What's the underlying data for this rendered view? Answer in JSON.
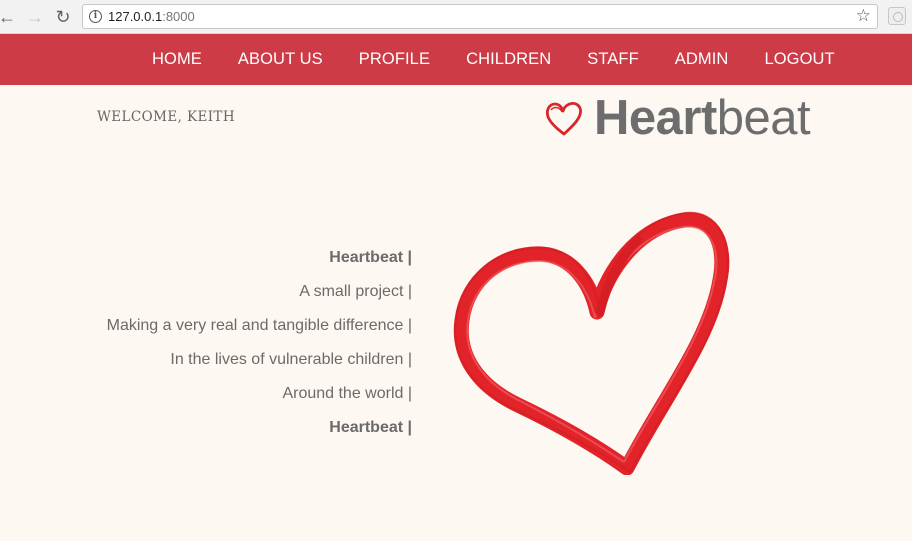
{
  "browser": {
    "url_host": "127.0.0.1",
    "url_port": ":8000",
    "back_icon": "arrow-left",
    "forward_icon": "arrow-right",
    "reload_icon": "reload",
    "bookmark_icon": "star-outline"
  },
  "nav": {
    "items": [
      {
        "label": "HOME"
      },
      {
        "label": "ABOUT US"
      },
      {
        "label": "PROFILE"
      },
      {
        "label": "CHILDREN"
      },
      {
        "label": "STAFF"
      },
      {
        "label": "ADMIN"
      },
      {
        "label": "LOGOUT"
      }
    ]
  },
  "header": {
    "welcome": "WELCOME, KEITH",
    "logo_bold": "Heart",
    "logo_light": "beat"
  },
  "tagline": {
    "lines": [
      "Heartbeat |",
      "A small project |",
      "Making a very real and tangible difference |",
      "In the lives of vulnerable children |",
      "Around the world |",
      "Heartbeat |"
    ]
  },
  "colors": {
    "nav_bg": "#cd3b47",
    "page_bg": "#fdf8f1",
    "heart_red": "#e0252a",
    "logo_gray": "#6d6d6d"
  }
}
